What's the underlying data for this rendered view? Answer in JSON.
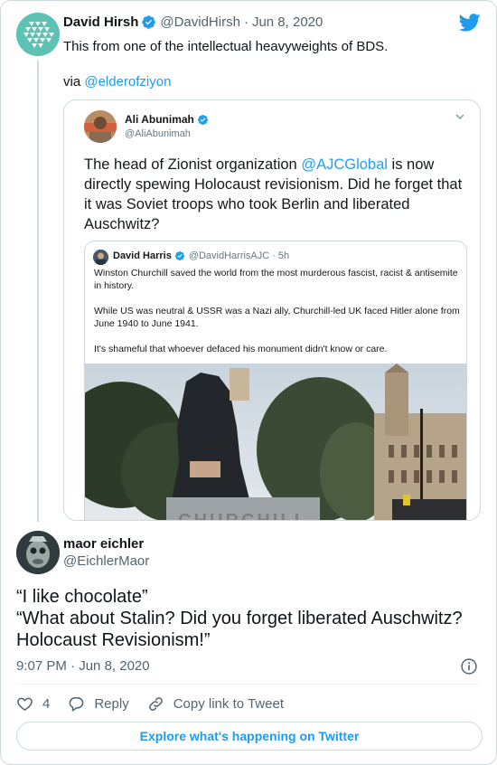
{
  "colors": {
    "accent": "#1d9bf0",
    "text": "#0f1419",
    "muted": "#536471",
    "border": "#cfd9de"
  },
  "parent_tweet": {
    "author_name": "David Hirsh",
    "author_handle": "@DavidHirsh",
    "separator": "·",
    "date": "Jun 8, 2020",
    "text": "This from one of the intellectual heavyweights of BDS.",
    "via_prefix": "via ",
    "via_link": "@elderofziyon",
    "icons": {
      "verified": "verified-badge-icon",
      "logo": "twitter-logo-icon"
    }
  },
  "embedded_image": {
    "author_name": "Ali Abunimah",
    "author_handle": "@AliAbunimah",
    "text_before": "The head of Zionist organization ",
    "text_mention": "@AJCGlobal",
    "text_after": " is now directly spewing Holocaust revisionism. Did he forget that it was Soviet troops who took Berlin and liberated Auschwitz?",
    "quoted": {
      "author_name": "David Harris",
      "author_handle": "@DavidHarrisAJC",
      "separator": "·",
      "time": "5h",
      "paragraphs": [
        "Winston Churchill saved the world from the most murderous fascist, racist & antisemite in history.",
        "While US was neutral & USSR was a Nazi ally, Churchill-led UK faced Hitler alone from June 1940 to June 1941.",
        "It's shameful that whoever defaced his monument didn't know or care."
      ],
      "photo_plinth_text": "CHURCHILL"
    }
  },
  "reply_tweet": {
    "author_name": "maor eichler",
    "author_handle": "@EichlerMaor",
    "lines": [
      "“I like chocolate”",
      "“What about Stalin? Did you forget liberated Auschwitz?",
      "Holocaust Revisionism!”"
    ],
    "time": "9:07 PM",
    "separator": "·",
    "date": "Jun 8, 2020"
  },
  "actions": {
    "like_count": "4",
    "reply_label": "Reply",
    "copy_label": "Copy link to Tweet"
  },
  "explore_label": "Explore what's happening on Twitter"
}
